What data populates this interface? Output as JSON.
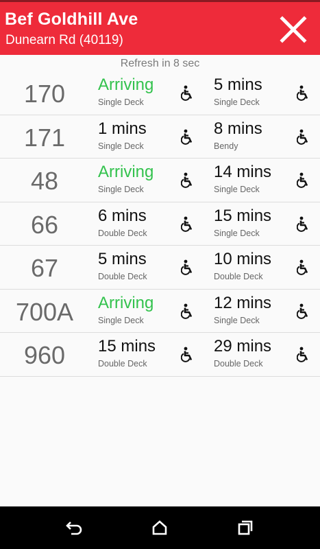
{
  "header": {
    "stop_name": "Bef Goldhill Ave",
    "stop_road": "Dunearn Rd (40119)",
    "close_icon": "close-icon"
  },
  "refresh_text": "Refresh in 8 sec",
  "colors": {
    "header_bg": "#ee2b3a",
    "arriving": "#33c24d",
    "service_number": "#6a6a6a"
  },
  "services": [
    {
      "number": "170",
      "next": {
        "eta": "Arriving",
        "type": "Single Deck",
        "arriving": true
      },
      "subsequent": {
        "eta": "5 mins",
        "type": "Single Deck",
        "arriving": false
      }
    },
    {
      "number": "171",
      "next": {
        "eta": "1 mins",
        "type": "Single Deck",
        "arriving": false
      },
      "subsequent": {
        "eta": "8 mins",
        "type": "Bendy",
        "arriving": false
      }
    },
    {
      "number": "48",
      "next": {
        "eta": "Arriving",
        "type": "Single Deck",
        "arriving": true
      },
      "subsequent": {
        "eta": "14 mins",
        "type": "Single Deck",
        "arriving": false
      }
    },
    {
      "number": "66",
      "next": {
        "eta": "6 mins",
        "type": "Double Deck",
        "arriving": false
      },
      "subsequent": {
        "eta": "15 mins",
        "type": "Single Deck",
        "arriving": false
      }
    },
    {
      "number": "67",
      "next": {
        "eta": "5 mins",
        "type": "Double Deck",
        "arriving": false
      },
      "subsequent": {
        "eta": "10 mins",
        "type": "Double Deck",
        "arriving": false
      }
    },
    {
      "number": "700A",
      "next": {
        "eta": "Arriving",
        "type": "Single Deck",
        "arriving": true
      },
      "subsequent": {
        "eta": "12 mins",
        "type": "Single Deck",
        "arriving": false
      }
    },
    {
      "number": "960",
      "next": {
        "eta": "15 mins",
        "type": "Double Deck",
        "arriving": false
      },
      "subsequent": {
        "eta": "29 mins",
        "type": "Double Deck",
        "arriving": false
      }
    }
  ],
  "wheelchair_icon": "wheelchair-accessible-icon",
  "navbar": {
    "back_icon": "back-icon",
    "home_icon": "home-icon",
    "recents_icon": "recents-icon"
  }
}
